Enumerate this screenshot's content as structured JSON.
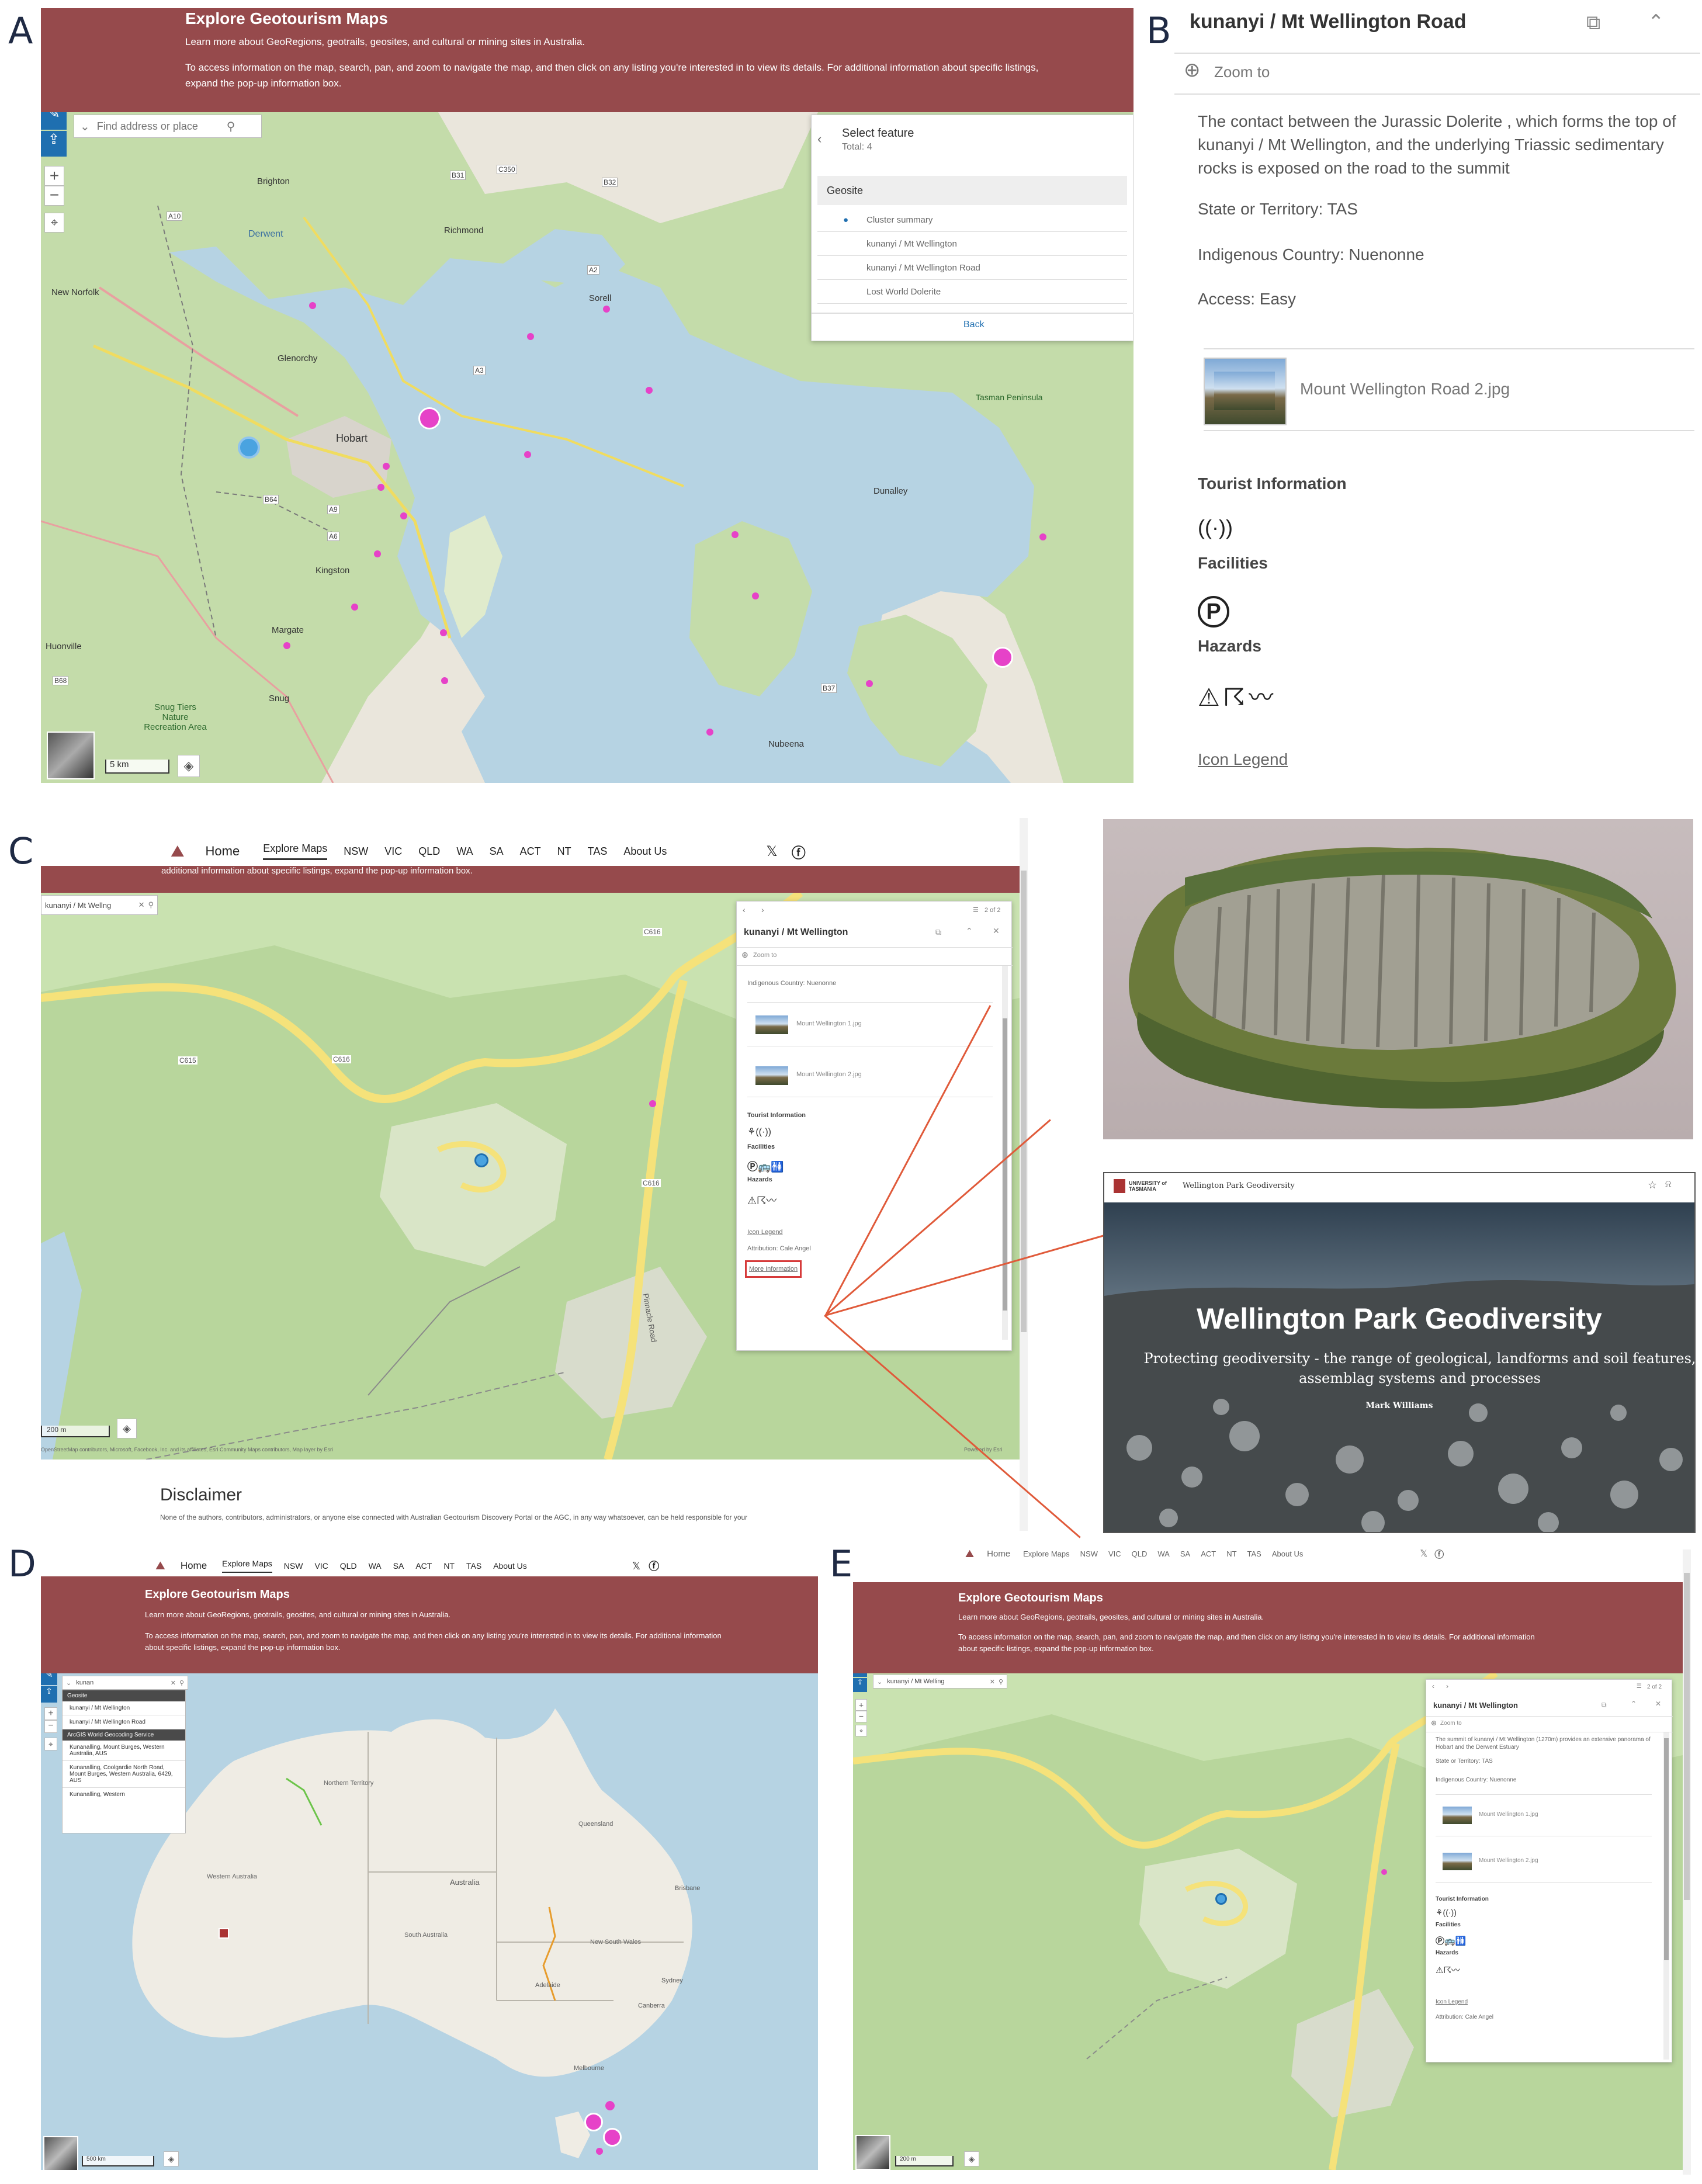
{
  "panel_letters": [
    "A",
    "B",
    "C",
    "D",
    "E"
  ],
  "colors": {
    "banner": "#964a4c",
    "water": "#b6d3e3",
    "land": "#eae6dc",
    "green": "#c4dcaa",
    "marker": "#e642c8",
    "road": "#f0dc60",
    "accent": "#1f6fb0"
  },
  "banner": {
    "title": "Explore Geotourism Maps",
    "line1": "Learn more about GeoRegions, geotrails, geosites, and cultural or mining sites in Australia.",
    "line2": "To access information on the map, search, pan, and zoom to navigate the map, and then click on any listing you're interested in to view its details. For additional information about specific listings, expand the pop-up information box."
  },
  "search": {
    "placeholder": "Find address or place"
  },
  "scale": {
    "a": "5 km",
    "c": "200 m",
    "d": "500 km",
    "e": "200 m"
  },
  "select_feature": {
    "title": "Select feature",
    "total": "Total: 4",
    "group": "Geosite",
    "items": [
      "Cluster summary",
      "kunanyi / Mt Wellington",
      "kunanyi / Mt Wellington Road",
      "Lost World Dolerite"
    ],
    "back": "Back"
  },
  "map_labels_a": [
    "Brighton",
    "Richmond",
    "Sorell",
    "New Norfolk",
    "Glenorchy",
    "Hobart",
    "Kingston",
    "Margate",
    "Dunalley",
    "Huonville",
    "Snug",
    "Nubeena",
    "Snug Tiers Nature Recreation Area",
    "Tasman Peninsula",
    "Derwent",
    "A10",
    "B31",
    "C350",
    "B32",
    "A3",
    "A9",
    "B37",
    "B64",
    "A6",
    "B68",
    "A2"
  ],
  "popup_b": {
    "title": "kunanyi / Mt Wellington Road",
    "zoom_to": "Zoom to",
    "description": "The contact between the Jurassic Dolerite , which forms the top of kunanyi / Mt Wellington, and the underlying Triassic sedimentary rocks is exposed on the road to the summit",
    "state": "State or Territory: TAS",
    "country": "Indigenous Country: Nuenonne",
    "access": "Access: Easy",
    "attachment": "Mount Wellington Road 2.jpg",
    "tourist_info": "Tourist Information",
    "facilities": "Facilities",
    "hazards": "Hazards",
    "legend": "Icon Legend"
  },
  "nav": {
    "home": "Home",
    "explore": "Explore Maps",
    "items": [
      "NSW",
      "VIC",
      "QLD",
      "WA",
      "SA",
      "ACT",
      "NT",
      "TAS",
      "About Us"
    ]
  },
  "c": {
    "banner_tail": "additional information about specific listings, expand the pop-up information box.",
    "search_value": "kunanyi / Mt Wellng",
    "popup_title": "kunanyi / Mt Wellington",
    "page": "2 of 2",
    "zoom_to": "Zoom to",
    "country": "Indigenous Country: Nuenonne",
    "att1": "Mount Wellington 1.jpg",
    "att2": "Mount Wellington 2.jpg",
    "tourist_info": "Tourist Information",
    "facilities": "Facilities",
    "hazards": "Hazards",
    "legend": "Icon Legend",
    "attribution": "Attribution: Cale Angel",
    "more_info": "More Information",
    "disclaimer_title": "Disclaimer",
    "disclaimer_text": "None of the authors, contributors, administrators, or anyone else connected with Australian Geotourism Discovery Portal or the AGC, in any way whatsoever, can be held responsible for your",
    "map_attribution": "OpenStreetMap contributors, Microsoft, Facebook, Inc. and its affiliates, Esri Community Maps contributors, Map layer by Esri",
    "powered": "Powered by Esri",
    "road_labels": [
      "C616",
      "C615",
      "C616",
      "C616",
      "Pinnacle Road"
    ]
  },
  "website": {
    "org": "UNIVERSITY of TASMANIA",
    "tab_title": "Wellington Park Geodiversity",
    "hero_title": "Wellington Park Geodiversity",
    "hero_sub": "Protecting geodiversity - the range of geological, landforms and soil features, assemblag systems and processes",
    "author": "Mark Williams"
  },
  "d": {
    "search_value": "kunan",
    "group": "Geosite",
    "items": [
      "kunanyi / Mt Wellington",
      "kunanyi / Mt Wellington Road"
    ],
    "service": "ArcGIS World Geocoding Service",
    "results": [
      "Kunanalling, Mount Burges, Western Australia, AUS",
      "Kunanalling, Coolgardie North Road, Mount Burges, Western Australia, 6429, AUS",
      "Kunanalling, Western"
    ],
    "map_labels": [
      "Northern Territory",
      "Western Australia",
      "Queensland",
      "South Australia",
      "New South Wales",
      "Australia",
      "Brisbane",
      "Sydney",
      "Canberra",
      "Adelaide",
      "Melbourne"
    ]
  },
  "e": {
    "search_value": "kunanyi / Mt Welling",
    "popup_title": "kunanyi / Mt Wellington",
    "page": "2 of 2",
    "zoom_to": "Zoom to",
    "description": "The summit of kunanyi / Mt Wellington (1270m) provides an extensive panorama of Hobart and the Derwent Estuary",
    "state": "State or Territory: TAS",
    "country": "Indigenous Country: Nuenonne",
    "att1": "Mount Wellington 1.jpg",
    "att2": "Mount Wellington 2.jpg",
    "tourist_info": "Tourist Information",
    "facilities": "Facilities",
    "hazards": "Hazards",
    "legend": "Icon Legend",
    "attribution": "Attribution: Cale Angel"
  },
  "icons": [
    "pencil-icon",
    "share-icon",
    "plus-icon",
    "minus-icon",
    "compass-icon",
    "layers-icon",
    "search-icon",
    "chevron-down-icon",
    "close-icon",
    "chevron-left-icon",
    "chevron-right-icon",
    "chevron-up-icon",
    "dock-icon",
    "list-icon",
    "zoom-icon",
    "signal-icon",
    "parking-icon",
    "bus-icon",
    "toilets-icon",
    "hazard-icon",
    "x-logo-icon",
    "facebook-icon",
    "star-icon",
    "bell-icon",
    "basemap-thumbnail-icon"
  ]
}
